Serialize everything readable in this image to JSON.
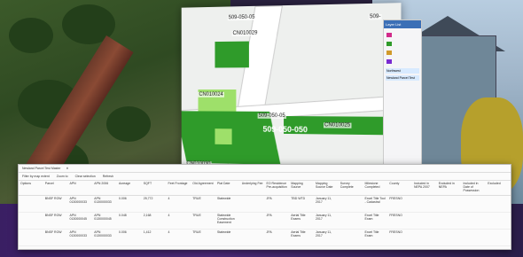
{
  "map": {
    "parcel_labels": [
      "509-050-05",
      "CN010029",
      "CN010024",
      "509-050-05",
      "509-050-050",
      "CN010025",
      "CN010030",
      "509-"
    ]
  },
  "layer_panel": {
    "title": "Layer List",
    "items": [
      "Northwest",
      "Newland Parcel Test"
    ]
  },
  "grid": {
    "title": "Newland Parcel Test Master",
    "tools": [
      "Filter by map extent",
      "Zoom to",
      "Clear selection",
      "Refresh"
    ],
    "columns": [
      "Options",
      "Parcel",
      "APN",
      "APN 2006",
      "Acreage",
      "SQFT",
      "Feet Frontage",
      "Old Agreement",
      "Plat Date",
      "Underlying Fee",
      "EO Residence Pre-acquisition",
      "Mapping Source",
      "Mapping Source Date",
      "Survey Complete",
      "Milestone Completed",
      "County",
      "Included in NEPA 2007",
      "Excluded in NEPA",
      "Included in Date of Possession",
      "Excluded"
    ],
    "rows": [
      [
        "",
        "BNSF ROW",
        "APN 0130000033",
        "APN 0130000033",
        "0.006",
        "25,772",
        "4",
        "TRUE",
        "Statewide",
        "",
        "JPA",
        "TBD WTD",
        "January 11, 2017",
        "",
        "Excel Title Tool - Cadastral",
        "FRESNO",
        "",
        "",
        "",
        ""
      ],
      [
        "",
        "BNSF ROW",
        "APN 0130000045",
        "APN 0130000045",
        "0.048",
        "2,168",
        "4",
        "TRUE",
        "Statewide Construction Easement",
        "",
        "JPA",
        "Aerial Title Exams",
        "January 11, 2017",
        "",
        "Excel Title Exam",
        "FRESNO",
        "",
        "",
        "",
        ""
      ],
      [
        "",
        "BNSF ROW",
        "APN 0130000033",
        "APN 0130000033",
        "0.006",
        "1,412",
        "4",
        "TRUE",
        "Statewide",
        "",
        "JPA",
        "Aerial Title Exams",
        "January 11, 2017",
        "",
        "Excel Title Exam",
        "FRESNO",
        "",
        "",
        "",
        ""
      ]
    ]
  },
  "colors": {
    "parcel_green": "#2f9b2a",
    "parcel_light": "#9ee06a",
    "accent_blue": "#3b6fb6"
  }
}
